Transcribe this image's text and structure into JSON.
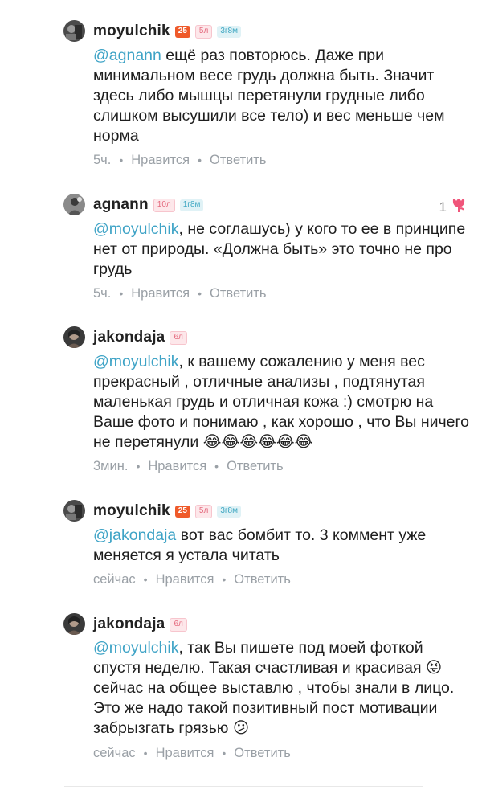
{
  "comments": [
    {
      "username": "moyulchik",
      "badges": {
        "rating": "25",
        "age": "5л",
        "time": "3г8м"
      },
      "mention": "@agnann",
      "text": " ещё раз повторюсь. Даже при минимальном весе грудь должна быть. Значит здесь либо мышцы перетянули грудные либо слишком высушили все тело) и вес меньше чем норма",
      "time": "5ч.",
      "like_label": "Нравится",
      "reply_label": "Ответить"
    },
    {
      "username": "agnann",
      "badges": {
        "age": "10л",
        "time": "1г8м"
      },
      "mention": "@moyulchik",
      "text": ", не соглашусь) у кого то ее в принципе нет от природы. «Должна быть» это точно не про грудь",
      "time": "5ч.",
      "like_label": "Нравится",
      "reply_label": "Ответить",
      "likes_count": "1"
    },
    {
      "username": "jakondaja",
      "badges": {
        "age": "6л"
      },
      "mention": "@moyulchik",
      "text": ", к вашему сожалению у меня вес прекрасный , отличные анализы , подтянутая маленькая грудь и отличная кожа :) смотрю на Ваше фото и понимаю , как хорошо , что Вы ничего не перетянули ",
      "emoji": "😂😂😂😂😂😂",
      "time": "3мин.",
      "like_label": "Нравится",
      "reply_label": "Ответить"
    },
    {
      "username": "moyulchik",
      "badges": {
        "rating": "25",
        "age": "5л",
        "time": "3г8м"
      },
      "mention": "@jakondaja",
      "text": " вот вас бомбит то. 3 коммент уже меняется  я устала читать",
      "time": "сейчас",
      "like_label": "Нравится",
      "reply_label": "Ответить"
    },
    {
      "username": "jakondaja",
      "badges": {
        "age": "6л"
      },
      "mention": "@moyulchik",
      "text_a": ", так Вы пишете под моей фоткой спустя неделю. Такая счастливая и красивая ",
      "emoji_a": "😝",
      "text_b": " сейчас на общее выставлю , чтобы знали в лицо. Это же надо такой позитивный пост мотивации забрызгать грязью ",
      "emoji_b": "😕",
      "time": "сейчас",
      "like_label": "Нравится",
      "reply_label": "Ответить"
    }
  ],
  "icons": {
    "like": "tulip-like-icon"
  },
  "colors": {
    "mention": "#3ea3c6",
    "rating_badge": "#ef5a2a",
    "age_badge": "#fde7ea",
    "time_badge": "#e0f2f6",
    "like_icon": "#f0557a"
  }
}
